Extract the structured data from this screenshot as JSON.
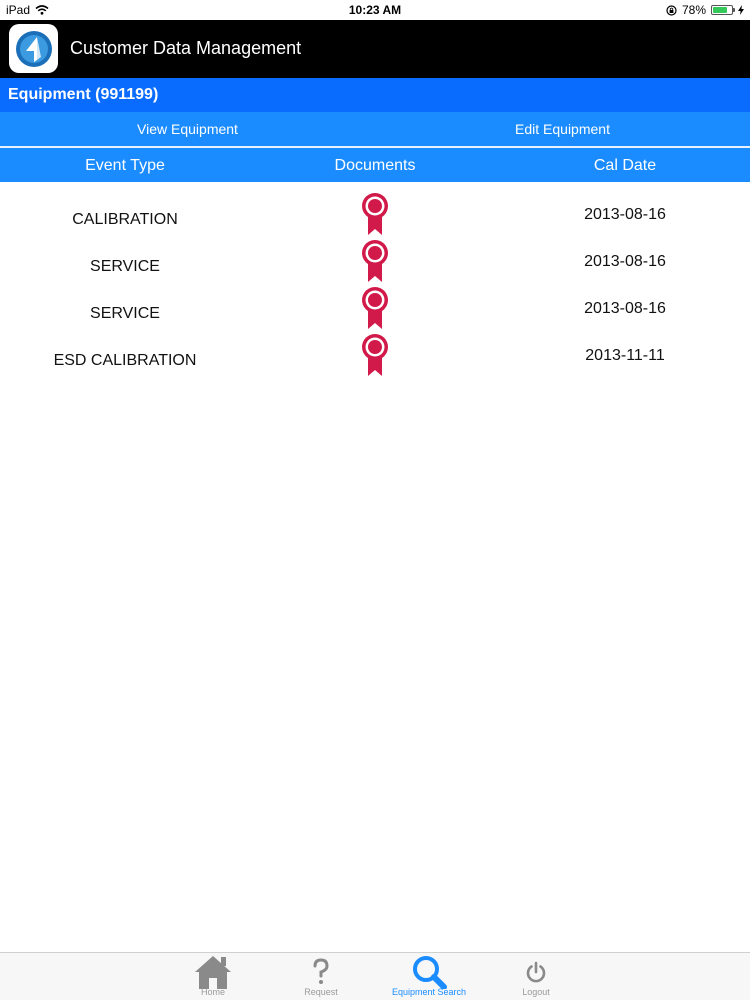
{
  "status_bar": {
    "device": "iPad",
    "time": "10:23 AM",
    "battery_percent": "78%",
    "battery_level": 0.78
  },
  "header": {
    "title": "Customer Data Management"
  },
  "equipment": {
    "title": "Equipment (991199)"
  },
  "tabs": [
    {
      "label": "View Equipment"
    },
    {
      "label": "Edit Equipment"
    }
  ],
  "columns": {
    "event_type": "Event Type",
    "documents": "Documents",
    "cal_date": "Cal Date"
  },
  "rows": [
    {
      "event_type": "CALIBRATION",
      "cal_date": "2013-08-16",
      "document_icon": "award-ribbon-icon"
    },
    {
      "event_type": "SERVICE",
      "cal_date": "2013-08-16",
      "document_icon": "award-ribbon-icon"
    },
    {
      "event_type": "SERVICE",
      "cal_date": "2013-08-16",
      "document_icon": "award-ribbon-icon"
    },
    {
      "event_type": "ESD CALIBRATION",
      "cal_date": "2013-11-11",
      "document_icon": "award-ribbon-icon"
    }
  ],
  "bottom_nav": [
    {
      "label": "Home",
      "icon": "home-icon",
      "active": false
    },
    {
      "label": "Request",
      "icon": "question-icon",
      "active": false
    },
    {
      "label": "Equipment Search",
      "icon": "search-icon",
      "active": true
    },
    {
      "label": "Logout",
      "icon": "power-icon",
      "active": false
    }
  ],
  "colors": {
    "equipment_bar": "#0a6cff",
    "tab_bar": "#1a8cff",
    "ribbon": "#d11a4a",
    "active_nav": "#1a8cff",
    "inactive_nav": "#9a9a9a"
  }
}
